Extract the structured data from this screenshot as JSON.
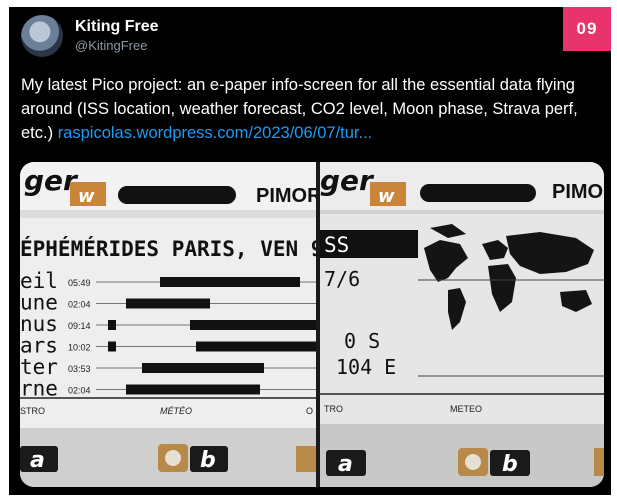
{
  "tweet": {
    "author_name": "Kiting Free",
    "author_handle": "@KitingFree",
    "badge": "09",
    "text": "My latest Pico project: an e-paper info-screen for all the essential data flying around (ISS location, weather forecast, CO2 level, Moon phase, Strava perf, etc.) ",
    "link": "raspicolas.wordpress.com/2023/06/07/tur..."
  },
  "photo": {
    "left_screen": {
      "brand_fragment": "PIMOR",
      "logo_fragment": "ger",
      "logo_badge": "w",
      "header": "ÉPHÉMÉRIDES PARIS, VEN 9",
      "rows": [
        {
          "label": "eil",
          "time": "05:49"
        },
        {
          "label": "une",
          "time": "02:04"
        },
        {
          "label": "nus",
          "time": "09:14"
        },
        {
          "label": "ars",
          "time": "10:02"
        },
        {
          "label": "ter",
          "time": "03:53"
        },
        {
          "label": "rne",
          "time": "02:04"
        }
      ],
      "footer_tabs": [
        "STRO",
        "MÉTÉO",
        "O"
      ],
      "buttons": [
        "a",
        "b"
      ]
    },
    "right_screen": {
      "brand_fragment": "PIMO",
      "logo_fragment": "ger",
      "logo_badge": "w",
      "header": "SS",
      "line1": "7/6",
      "line2": "0 S",
      "line3": "104 E",
      "footer_tabs": [
        "TRO",
        "METEO"
      ],
      "buttons": [
        "a",
        "b"
      ]
    }
  },
  "colors": {
    "background": "#000000",
    "badge": "#e8336d",
    "link": "#1d9bf0",
    "handle": "#8b98a5",
    "logo_badge": "#c9853a"
  }
}
